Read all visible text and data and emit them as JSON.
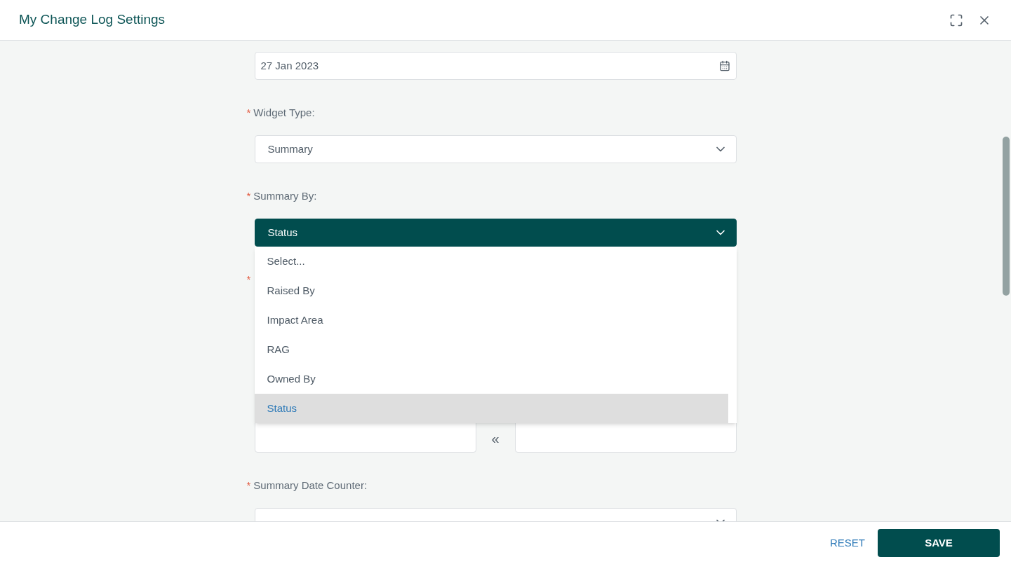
{
  "window": {
    "title": "My Change Log Settings"
  },
  "fields": [
    {
      "kind": "date",
      "value": "27 Jan 2023"
    },
    {
      "kind": "select",
      "required_mark": "*",
      "label": "Widget Type:",
      "value": "Summary",
      "open": false
    },
    {
      "kind": "select",
      "required_mark": "*",
      "label": "Summary By:",
      "value": "Status",
      "open": true,
      "options": [
        {
          "label": "Select...",
          "selected": false
        },
        {
          "label": "Raised By",
          "selected": false
        },
        {
          "label": "Impact Area",
          "selected": false
        },
        {
          "label": "RAG",
          "selected": false
        },
        {
          "label": "Owned By",
          "selected": false
        },
        {
          "label": "Status",
          "selected": true
        }
      ]
    },
    {
      "kind": "dual-list",
      "required_mark": "*",
      "move_label": "«"
    },
    {
      "kind": "select",
      "required_mark": "*",
      "label": "Summary Date Counter:",
      "open": false
    }
  ],
  "footer": {
    "buttons": [
      {
        "label": "RESET",
        "kind": "link"
      },
      {
        "label": "SAVE",
        "kind": "primary"
      }
    ]
  }
}
